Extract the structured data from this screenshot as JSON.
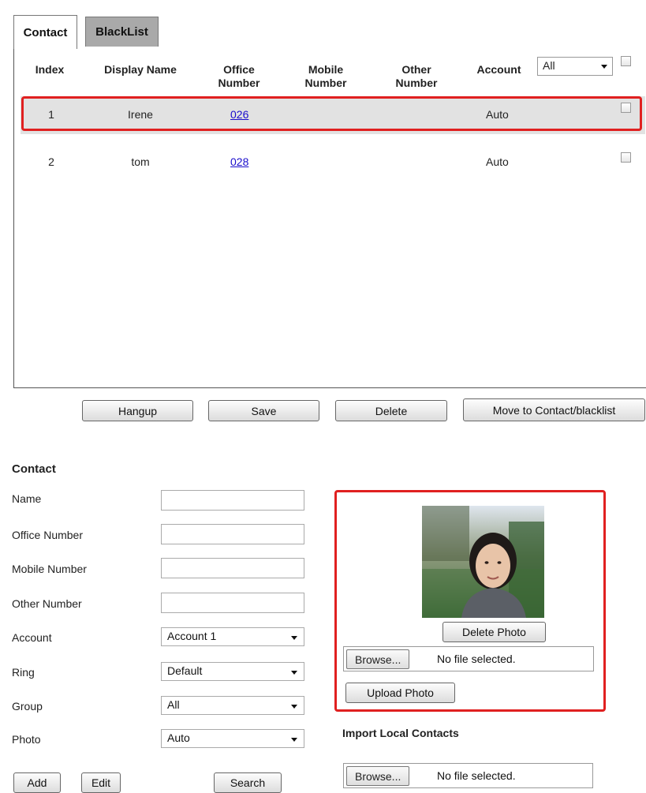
{
  "tabs": [
    {
      "label": "Contact",
      "active": true
    },
    {
      "label": "BlackList",
      "active": false
    }
  ],
  "table": {
    "headers": {
      "index": "Index",
      "display_name": "Display Name",
      "office_line1": "Office",
      "office_line2": "Number",
      "mobile_line1": "Mobile",
      "mobile_line2": "Number",
      "other_line1": "Other",
      "other_line2": "Number",
      "account": "Account"
    },
    "account_filter": "All",
    "rows": [
      {
        "index": "1",
        "name": "Irene",
        "office": "026",
        "mobile": "",
        "other": "",
        "account": "Auto",
        "selected": true
      },
      {
        "index": "2",
        "name": "tom",
        "office": "028",
        "mobile": "",
        "other": "",
        "account": "Auto",
        "selected": false
      }
    ]
  },
  "actions": {
    "hangup": "Hangup",
    "save": "Save",
    "delete": "Delete",
    "move": "Move to Contact/blacklist"
  },
  "contact_form": {
    "title": "Contact",
    "name_label": "Name",
    "office_label": "Office Number",
    "mobile_label": "Mobile Number",
    "other_label": "Other Number",
    "account_label": "Account",
    "account_value": "Account 1",
    "ring_label": "Ring",
    "ring_value": "Default",
    "group_label": "Group",
    "group_value": "All",
    "photo_label": "Photo",
    "photo_value": "Auto",
    "add_label": "Add",
    "edit_label": "Edit",
    "search_label": "Search"
  },
  "photo_panel": {
    "delete_photo": "Delete Photo",
    "browse": "Browse...",
    "no_file": "No file selected.",
    "upload_photo": "Upload Photo"
  },
  "import": {
    "title": "Import Local Contacts",
    "browse": "Browse...",
    "no_file": "No file selected."
  },
  "colors": {
    "highlight_border": "#e02020",
    "link": "#1a0dcc",
    "inactive_tab": "#a9a9a9",
    "selected_row": "#e2e2e2"
  }
}
